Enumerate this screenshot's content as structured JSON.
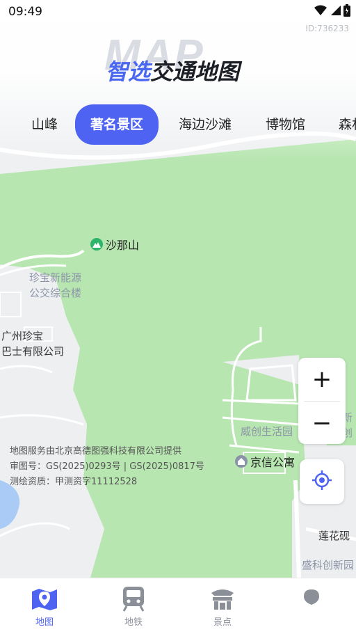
{
  "status": {
    "time": "09:49"
  },
  "map_id": "ID:736233",
  "brand": {
    "bg_text": "MAP",
    "title_highlight": "智选",
    "title_rest": "交通地图"
  },
  "categories": [
    {
      "label": "山峰"
    },
    {
      "label": "著名景区",
      "active": true
    },
    {
      "label": "海边沙滩"
    },
    {
      "label": "博物馆"
    },
    {
      "label": "森林"
    }
  ],
  "map": {
    "pois": [
      {
        "label": "沙那山",
        "icon": "mountain-pin-icon"
      },
      {
        "label": "京信公寓",
        "icon": "building-pin-icon"
      }
    ],
    "labels": {
      "bus_depot": "珍宝新能源\n公交综合楼",
      "company": "广州珍宝\n巴士有限公司",
      "residence": "威创生活园",
      "road": "莲花砚",
      "park": "盛科创新园",
      "edge_right": "新创"
    },
    "credits": [
      "地图服务由北京高德图强科技有限公司提供",
      "审图号：GS(2025)0293号 | GS(2025)0817号",
      "测绘资质：甲测资字11112528"
    ]
  },
  "controls": {
    "zoom_in": "+",
    "zoom_out": "−"
  },
  "tabs": [
    {
      "label": "地图",
      "icon": "map-icon",
      "active": true
    },
    {
      "label": "地铁",
      "icon": "subway-icon"
    },
    {
      "label": "景点",
      "icon": "landmark-icon"
    },
    {
      "label": "",
      "icon": "profile-icon"
    }
  ],
  "colors": {
    "accent": "#4e63f2",
    "park_green": "#b7e6b0"
  }
}
